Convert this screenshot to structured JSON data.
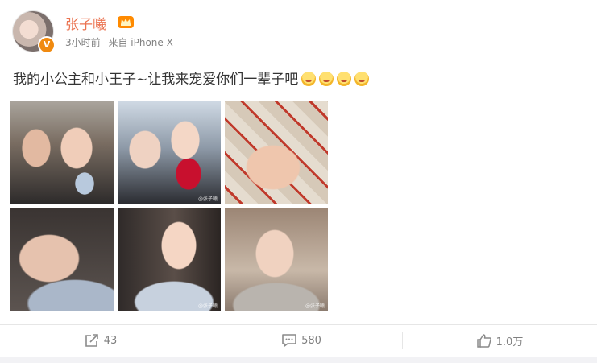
{
  "post": {
    "username": "张子曦",
    "time": "3小时前",
    "source": "来自 iPhone X",
    "text": "我的小公主和小王子~让我来宠爱你们一辈子吧",
    "emoji_count": 4,
    "watermark": "@张子曦"
  },
  "actions": {
    "repost_count": "43",
    "comment_count": "580",
    "like_count": "1.0万"
  },
  "colors": {
    "username": "#eb7350",
    "meta": "#808080",
    "text": "#333333",
    "badge": "#f08a10"
  },
  "icons": {
    "verified": "verified-v-icon",
    "vip": "vip-crown-icon",
    "repost": "repost-icon",
    "comment": "comment-icon",
    "like": "thumbs-up-icon"
  }
}
